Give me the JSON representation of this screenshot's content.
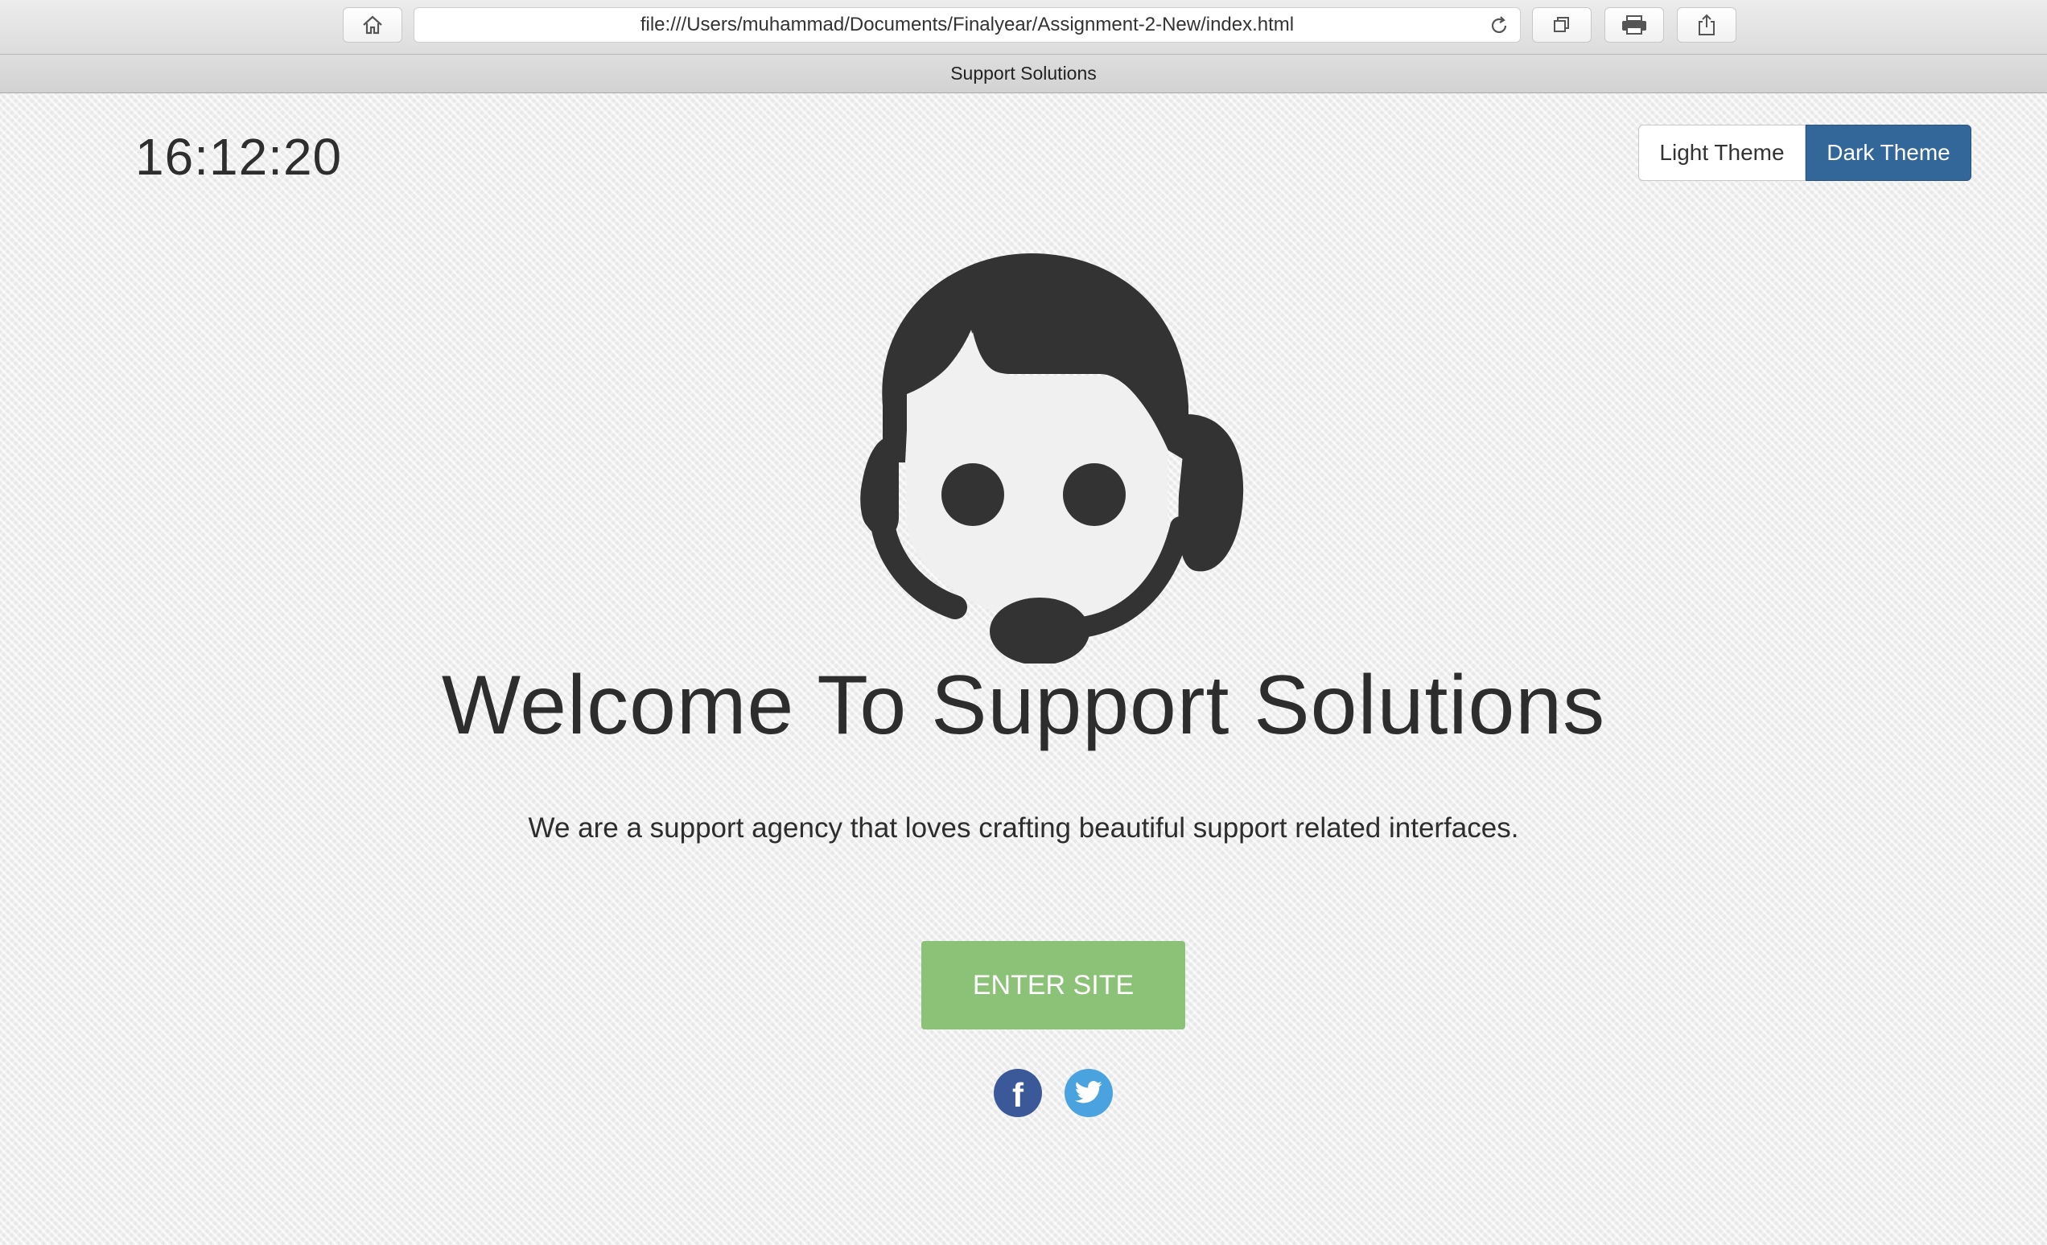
{
  "browser": {
    "url": "file:///Users/muhammad/Documents/Finalyear/Assignment-2-New/index.html",
    "tab_title": "Support Solutions",
    "icons": [
      "home-icon",
      "reload-icon",
      "tabs-icon",
      "print-icon",
      "share-icon"
    ]
  },
  "page": {
    "clock": "16:12:20",
    "theme_toggle": {
      "light_label": "Light Theme",
      "dark_label": "Dark Theme",
      "active": "Dark Theme"
    },
    "hero_icon": "support-agent-headset-icon",
    "headline": "Welcome To Support Solutions",
    "tagline": "We are a support agency that loves crafting beautiful support related interfaces.",
    "enter_button": "ENTER SITE",
    "social": {
      "facebook_glyph": "f",
      "icons": [
        "facebook-icon",
        "twitter-icon"
      ]
    }
  },
  "colors": {
    "dark_theme_button": "#336699",
    "enter_button": "#8cc178",
    "facebook": "#3b5998",
    "twitter": "#4aa3df",
    "text": "#2d2d2d"
  }
}
